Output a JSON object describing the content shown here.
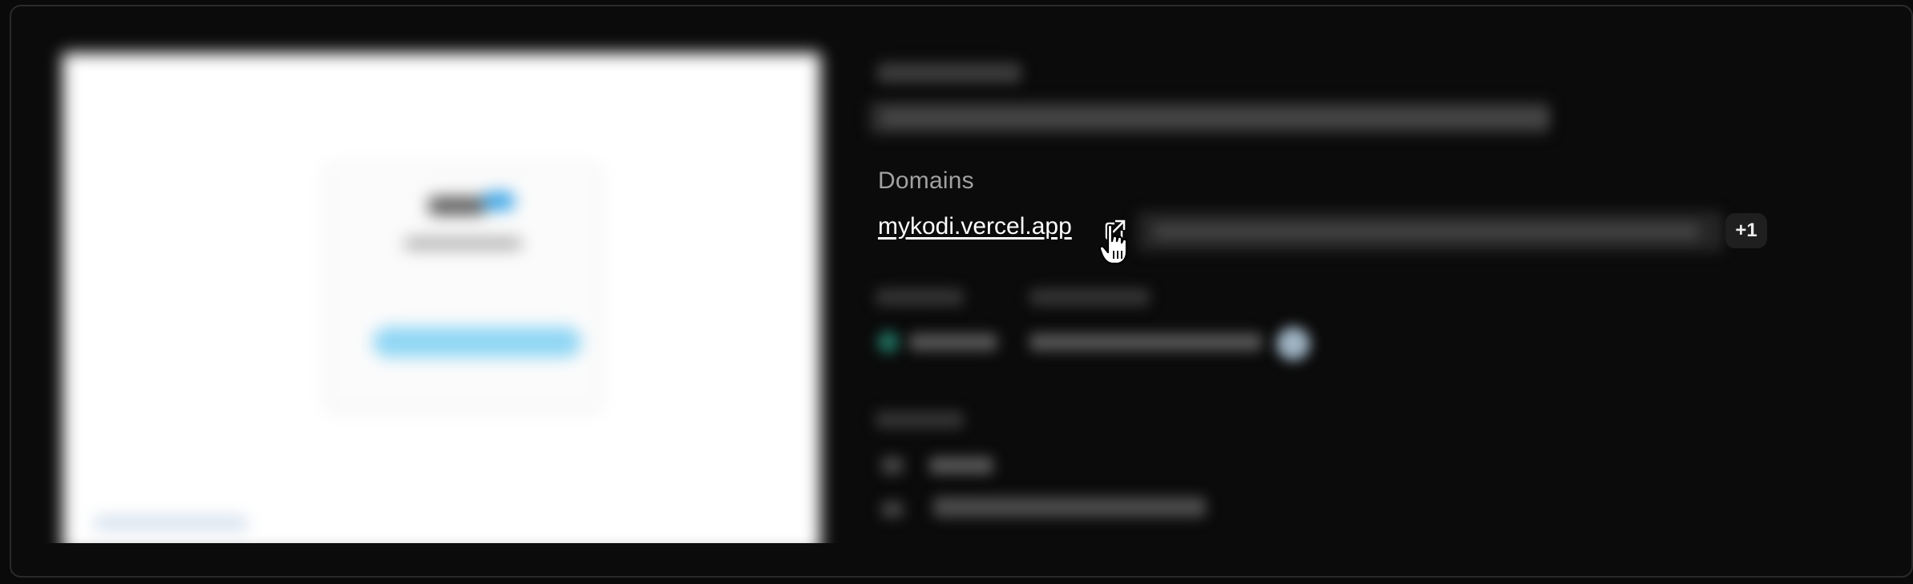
{
  "domains": {
    "label": "Domains",
    "primary": "mykodi.vercel.app",
    "more_count": "+1"
  },
  "icons": {
    "external_link": "external-link-icon",
    "cursor": "hand-pointer-cursor-icon"
  },
  "colors": {
    "background": "#0a0a0a",
    "card_border": "#2a2a2a",
    "label": "#a1a1a1",
    "link": "#ffffff",
    "badge_bg": "#1f1f1f"
  }
}
